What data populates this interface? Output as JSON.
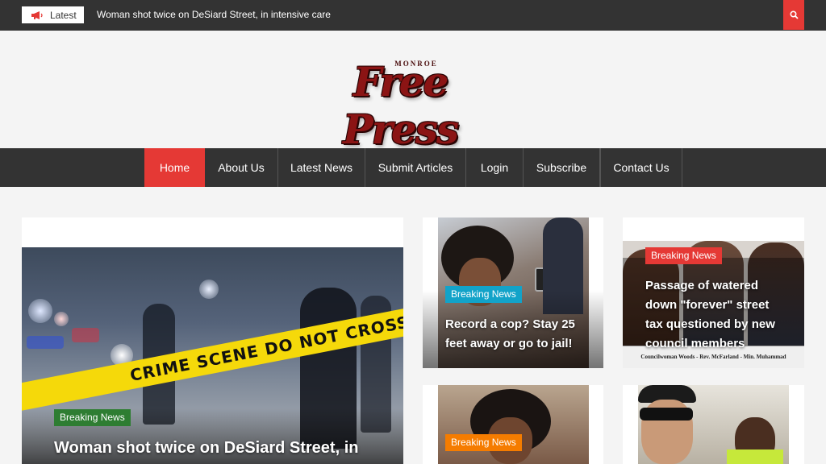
{
  "topbar": {
    "latest_label": "Latest",
    "ticker_text": "Woman shot twice on DeSiard Street, in intensive care",
    "search_icon": "search-icon",
    "accent": "#e53935"
  },
  "logo": {
    "small_text": "MONROE",
    "main_text": "Free Press"
  },
  "nav": {
    "items": [
      {
        "label": "Home"
      },
      {
        "label": "About Us"
      },
      {
        "label": "Latest News"
      },
      {
        "label": "Submit Articles"
      },
      {
        "label": "Login"
      },
      {
        "label": "Subscribe"
      },
      {
        "label": "Contact Us"
      }
    ]
  },
  "featured": {
    "tag": "Breaking News",
    "headline": "Woman shot twice on DeSiard Street, in",
    "tape_text": "CRIME SCENE DO NOT CROSS"
  },
  "cards": [
    {
      "tag": "Breaking News",
      "headline": "Record a cop? Stay 25 feet away or go to jail!"
    },
    {
      "tag": "Breaking News",
      "headline": "Passage of watered down \"forever\" street tax questioned by new council members",
      "caption": "Councilwoman Woods - Rev. McFarland - Min. Muhammad"
    },
    {
      "tag": "Breaking News"
    },
    {}
  ],
  "colors": {
    "dark_bar": "#333333",
    "accent_red": "#e53935",
    "tag_green": "#2e7d32",
    "tag_cyan": "#12a3c9",
    "tag_orange": "#f57c00"
  }
}
